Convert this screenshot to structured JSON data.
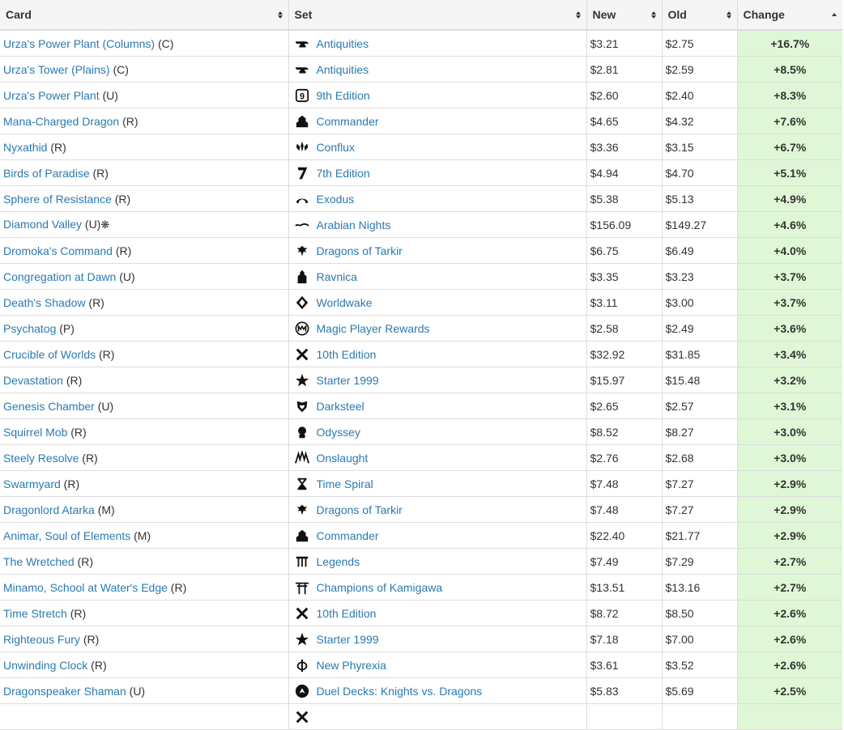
{
  "headers": {
    "card": "Card",
    "set": "Set",
    "new": "New",
    "old": "Old",
    "change": "Change"
  },
  "rows": [
    {
      "card": "Urza's Power Plant (Columns)",
      "rarity": " (C)",
      "set": "Antiquities",
      "icon": "anvil-icon",
      "new": "$3.21",
      "old": "$2.75",
      "change": "+16.7%"
    },
    {
      "card": "Urza's Tower (Plains)",
      "rarity": " (C)",
      "set": "Antiquities",
      "icon": "anvil-icon",
      "new": "$2.81",
      "old": "$2.59",
      "change": "+8.5%"
    },
    {
      "card": "Urza's Power Plant",
      "rarity": " (U)",
      "set": "9th Edition",
      "icon": "ninth-edition-icon",
      "new": "$2.60",
      "old": "$2.40",
      "change": "+8.3%"
    },
    {
      "card": "Mana-Charged Dragon",
      "rarity": " (R)",
      "set": "Commander",
      "icon": "commander-icon",
      "new": "$4.65",
      "old": "$4.32",
      "change": "+7.6%"
    },
    {
      "card": "Nyxathid",
      "rarity": " (R)",
      "set": "Conflux",
      "icon": "conflux-icon",
      "new": "$3.36",
      "old": "$3.15",
      "change": "+6.7%"
    },
    {
      "card": "Birds of Paradise",
      "rarity": " (R)",
      "set": "7th Edition",
      "icon": "seventh-edition-icon",
      "new": "$4.94",
      "old": "$4.70",
      "change": "+5.1%"
    },
    {
      "card": "Sphere of Resistance",
      "rarity": " (R)",
      "set": "Exodus",
      "icon": "exodus-icon",
      "new": "$5.38",
      "old": "$5.13",
      "change": "+4.9%"
    },
    {
      "card": "Diamond Valley",
      "rarity": " (U)",
      "foil": "❋",
      "set": "Arabian Nights",
      "icon": "arabian-nights-icon",
      "new": "$156.09",
      "old": "$149.27",
      "change": "+4.6%"
    },
    {
      "card": "Dromoka's Command",
      "rarity": " (R)",
      "set": "Dragons of Tarkir",
      "icon": "dragon-icon",
      "new": "$6.75",
      "old": "$6.49",
      "change": "+4.0%"
    },
    {
      "card": "Congregation at Dawn",
      "rarity": " (U)",
      "set": "Ravnica",
      "icon": "ravnica-icon",
      "new": "$3.35",
      "old": "$3.23",
      "change": "+3.7%"
    },
    {
      "card": "Death's Shadow",
      "rarity": " (R)",
      "set": "Worldwake",
      "icon": "worldwake-icon",
      "new": "$3.11",
      "old": "$3.00",
      "change": "+3.7%"
    },
    {
      "card": "Psychatog",
      "rarity": " (P)",
      "set": "Magic Player Rewards",
      "icon": "player-rewards-icon",
      "new": "$2.58",
      "old": "$2.49",
      "change": "+3.6%"
    },
    {
      "card": "Crucible of Worlds",
      "rarity": " (R)",
      "set": "10th Edition",
      "icon": "tenth-edition-icon",
      "new": "$32.92",
      "old": "$31.85",
      "change": "+3.4%"
    },
    {
      "card": "Devastation",
      "rarity": " (R)",
      "set": "Starter 1999",
      "icon": "starter-star-icon",
      "new": "$15.97",
      "old": "$15.48",
      "change": "+3.2%"
    },
    {
      "card": "Genesis Chamber",
      "rarity": " (U)",
      "set": "Darksteel",
      "icon": "darksteel-icon",
      "new": "$2.65",
      "old": "$2.57",
      "change": "+3.1%"
    },
    {
      "card": "Squirrel Mob",
      "rarity": " (R)",
      "set": "Odyssey",
      "icon": "odyssey-icon",
      "new": "$8.52",
      "old": "$8.27",
      "change": "+3.0%"
    },
    {
      "card": "Steely Resolve",
      "rarity": " (R)",
      "set": "Onslaught",
      "icon": "onslaught-icon",
      "new": "$2.76",
      "old": "$2.68",
      "change": "+3.0%"
    },
    {
      "card": "Swarmyard",
      "rarity": " (R)",
      "set": "Time Spiral",
      "icon": "hourglass-icon",
      "new": "$7.48",
      "old": "$7.27",
      "change": "+2.9%"
    },
    {
      "card": "Dragonlord Atarka",
      "rarity": " (M)",
      "set": "Dragons of Tarkir",
      "icon": "dragon-icon",
      "new": "$7.48",
      "old": "$7.27",
      "change": "+2.9%"
    },
    {
      "card": "Animar, Soul of Elements",
      "rarity": " (M)",
      "set": "Commander",
      "icon": "commander-icon",
      "new": "$22.40",
      "old": "$21.77",
      "change": "+2.9%"
    },
    {
      "card": "The Wretched",
      "rarity": " (R)",
      "set": "Legends",
      "icon": "legends-icon",
      "new": "$7.49",
      "old": "$7.29",
      "change": "+2.7%"
    },
    {
      "card": "Minamo, School at Water's Edge",
      "rarity": " (R)",
      "set": "Champions of Kamigawa",
      "icon": "torii-icon",
      "new": "$13.51",
      "old": "$13.16",
      "change": "+2.7%"
    },
    {
      "card": "Time Stretch",
      "rarity": " (R)",
      "set": "10th Edition",
      "icon": "tenth-edition-icon",
      "new": "$8.72",
      "old": "$8.50",
      "change": "+2.6%"
    },
    {
      "card": "Righteous Fury",
      "rarity": " (R)",
      "set": "Starter 1999",
      "icon": "starter-star-icon",
      "new": "$7.18",
      "old": "$7.00",
      "change": "+2.6%"
    },
    {
      "card": "Unwinding Clock",
      "rarity": " (R)",
      "set": "New Phyrexia",
      "icon": "phyrexia-icon",
      "new": "$3.61",
      "old": "$3.52",
      "change": "+2.6%"
    },
    {
      "card": "Dragonspeaker Shaman",
      "rarity": " (U)",
      "set": "Duel Decks: Knights vs. Dragons",
      "icon": "knights-vs-dragons-icon",
      "new": "$5.83",
      "old": "$5.69",
      "change": "+2.5%"
    },
    {
      "card": "",
      "rarity": "",
      "set": "",
      "icon": "tenth-edition-icon",
      "new": "",
      "old": "",
      "change": ""
    }
  ]
}
